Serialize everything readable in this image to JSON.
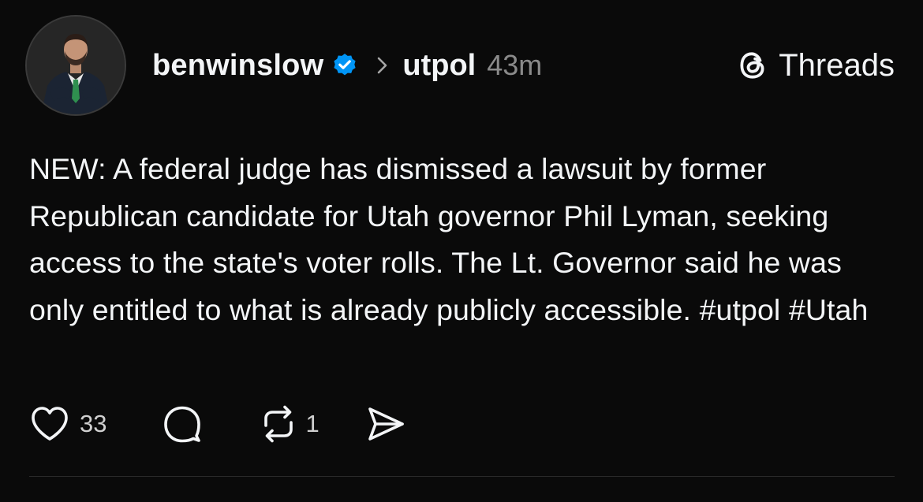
{
  "post": {
    "username": "benwinslow",
    "topic": "utpol",
    "time": "43m",
    "brand": "Threads",
    "text": "NEW: A federal judge has dismissed a lawsuit by former Republican candidate for Utah governor Phil Lyman, seeking access to the state's voter rolls. The Lt. Governor said he was only entitled to what is already publicly accessible. #utpol #Utah",
    "likes": "33",
    "reposts": "1"
  },
  "icons": {
    "verified": "verified-badge-icon",
    "chevron": "chevron-right-icon",
    "brand": "threads-logo-icon",
    "like": "heart-icon",
    "reply": "comment-icon",
    "repost": "repost-icon",
    "share": "send-icon"
  },
  "colors": {
    "background": "#0a0a0a",
    "text": "#f3f5f7",
    "muted": "#8a8a8a",
    "verified": "#0095f6"
  }
}
